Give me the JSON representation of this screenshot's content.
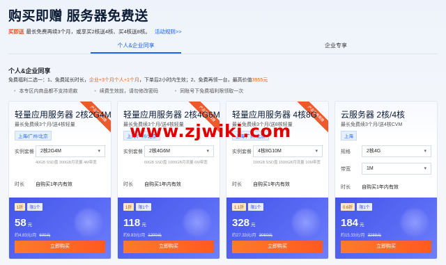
{
  "header": {
    "title": "购买即赠 服务器免费送"
  },
  "promo": {
    "tag": "买即送",
    "text": "最长免费再续3个月，或享买2核送4核、买4核送8核。",
    "link": "活动规则>>"
  },
  "tabs": [
    {
      "label": "个人&企业同享"
    },
    {
      "label": "企业专享"
    }
  ],
  "section": {
    "title": "个人&企业同享",
    "rule_a": "免费福利二选一：1、免费延长时长，",
    "rule_hl": "企业+3个月个人+1个月",
    "rule_b": "，下单后2小时内生效；2、免费再领一台，最高价值",
    "rule_val": "3955元",
    "notes": [
      "本专区内商品都不支持退款",
      "续费生效前，请勿修改密码",
      "同账号下免费福利限领取一次"
    ]
  },
  "labels": {
    "plan": "实例套餐",
    "spec": "规格",
    "bandwidth": "带宽",
    "duration": "时长",
    "duration_value": "自购买1年内有效",
    "buy": "立即购买",
    "ribbon": "产品免费再赠"
  },
  "cards": [
    {
      "name": "轻量应用服务器 2核2G4M",
      "sub": "最长免费续3个月/送4核轻量",
      "region": "上海/广州/北京",
      "plan": "2核2G4M",
      "note": "40GB SSD盘 300GB月流量 4M带宽",
      "discount": "1折",
      "limit": "限1个",
      "price": "58",
      "price_unit": "元",
      "monthly": "约4.83元/月",
      "orig": "600元"
    },
    {
      "name": "轻量应用服务器 2核4G6M",
      "sub": "最长免费续3个月/送4核轻量",
      "region": "上海/广州/北京",
      "plan": "2核4G6M",
      "note": "60GB SSD盘 1000GB月流量 6M带宽",
      "discount": "1折",
      "limit": "限1个",
      "price": "118",
      "price_unit": "元",
      "monthly": "约9.83元/月",
      "orig": "1200元"
    },
    {
      "name": "轻量应用服务器 4核8G",
      "sub": "最长免费续3个月/送8核轻量",
      "region": "上海/广州/北京",
      "plan": "4核8G10M",
      "note": "100GB SSD盘 1500GB月流量 10M带宽",
      "discount": "1.1折",
      "limit": "限1个",
      "price": "328",
      "price_unit": "元",
      "monthly": "约27.33元/月",
      "orig": "3060元"
    },
    {
      "name": "云服务器 2核/4核",
      "sub": "最长免费续3个月/送4核CVM",
      "region": "上海",
      "spec": "2核4G",
      "bandwidth": "1M",
      "discount": "0.6折",
      "limit": "限1个",
      "price": "184",
      "price_unit": "元",
      "monthly": "约15.33元/月",
      "orig": "3288元"
    }
  ],
  "watermark": "www.zjwiki.com",
  "colors": {
    "accent": "#1a64f0",
    "price_panel": "#4456e8",
    "buy_button": "#ff5a1f",
    "watermark": "#e00000"
  }
}
